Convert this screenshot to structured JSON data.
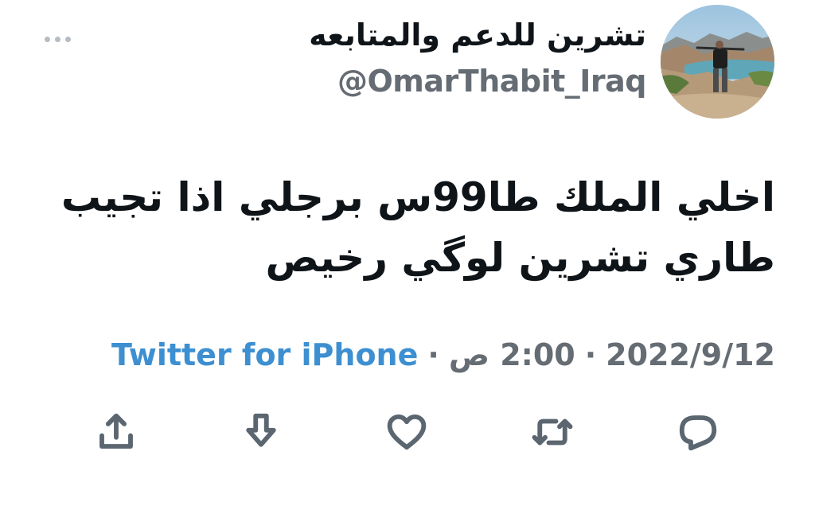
{
  "tweet": {
    "display_name": "تشرين للدعم والمتابعه",
    "handle": "@OmarThabit_Iraq",
    "text_lines": [
      "اخلي الملك طا99س برجلي اذا تجيب",
      "طاري تشرين لوگي رخيص"
    ],
    "meta": {
      "date": "2022/9/12",
      "time": "2:00 ص",
      "separator": "·",
      "source": "Twitter for iPhone"
    },
    "actions": [
      {
        "name": "share",
        "icon": "share-icon"
      },
      {
        "name": "download",
        "icon": "download-icon"
      },
      {
        "name": "like",
        "icon": "heart-icon"
      },
      {
        "name": "retweet",
        "icon": "retweet-icon"
      },
      {
        "name": "reply",
        "icon": "reply-icon"
      }
    ]
  },
  "colors": {
    "text_primary": "#0f1419",
    "text_secondary": "#656c73",
    "link": "#3d8fd1",
    "icon": "#5b6670",
    "background": "#ffffff"
  }
}
